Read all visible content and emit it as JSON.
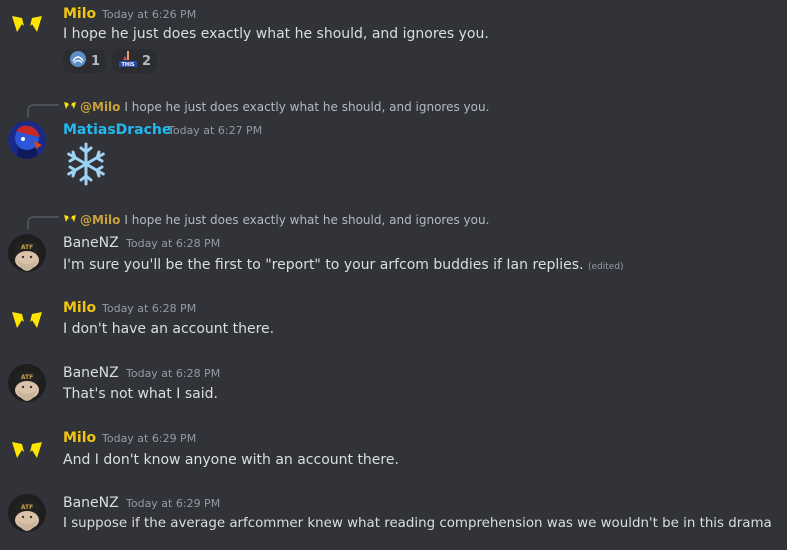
{
  "colors": {
    "background": "#313338",
    "milo": "#f1c40f",
    "matias": "#22b8f0",
    "banenz": "#dbdee1",
    "text": "#dbdee1",
    "muted": "#949ba4"
  },
  "messages": [
    {
      "author": "Milo",
      "timestamp": "Today at 6:26 PM",
      "text": "I hope he just does exactly what he should, and ignores you.",
      "reactions": [
        {
          "icon": "fan-emoji-icon",
          "count": "1"
        },
        {
          "icon": "this-emoji-icon",
          "count": "2"
        }
      ]
    },
    {
      "reply": {
        "mention": "@Milo",
        "text": "I hope he just does exactly what he should, and ignores you."
      },
      "author": "MatiasDrache",
      "timestamp": "Today at 6:27 PM",
      "emoji": "snowflake-icon"
    },
    {
      "reply": {
        "mention": "@Milo",
        "text": "I hope he just does exactly what he should, and ignores you."
      },
      "author": "BaneNZ",
      "timestamp": "Today at 6:28 PM",
      "text": "I'm sure you'll be the first to \"report\" to your arfcom buddies if Ian replies.",
      "edited": "(edited)"
    },
    {
      "author": "Milo",
      "timestamp": "Today at 6:28 PM",
      "text": "I don't have an account there."
    },
    {
      "author": "BaneNZ",
      "timestamp": "Today at 6:28 PM",
      "text": "That's not what I said."
    },
    {
      "author": "Milo",
      "timestamp": "Today at 6:29 PM",
      "text": "And I don't know anyone with an account there."
    },
    {
      "author": "BaneNZ",
      "timestamp": "Today at 6:29 PM",
      "text": "I suppose if the average arfcommer knew what reading comprehension was we wouldn't be in this drama"
    }
  ]
}
